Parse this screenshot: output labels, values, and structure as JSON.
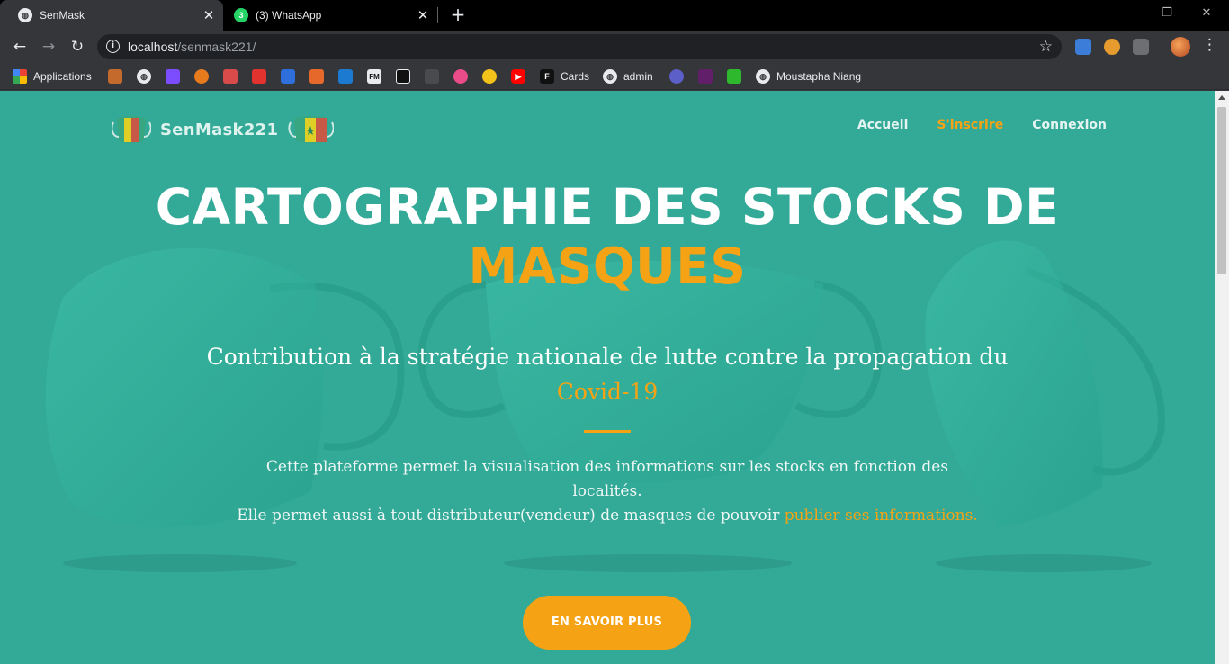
{
  "browser": {
    "tabs": [
      {
        "title": "SenMask",
        "active": true
      },
      {
        "title": "(3) WhatsApp",
        "active": false,
        "badge": "3"
      }
    ],
    "url_host": "localhost",
    "url_path": "/senmask221/",
    "bookmarks": {
      "apps_label": "Applications",
      "cards_label": "Cards",
      "admin_label": "admin",
      "profile_label": "Moustapha Niang",
      "fm_label": "FM"
    }
  },
  "colors": {
    "page_background": "#33a997",
    "accent": "#f5a314",
    "text": "#ffffff"
  },
  "site": {
    "brand": "SenMask221",
    "nav": [
      {
        "label": "Accueil",
        "active": false
      },
      {
        "label": "S'inscrire",
        "active": true
      },
      {
        "label": "Connexion",
        "active": false
      }
    ],
    "hero": {
      "title_line1": "CARTOGRAPHIE DES STOCKS DE",
      "title_accent": "MASQUES",
      "subtitle": "Contribution à la stratégie nationale de lutte contre la propagation du",
      "subtitle_accent": "Covid-19",
      "desc_line1": "Cette plateforme permet la visualisation des informations sur les stocks en fonction des localités.",
      "desc_line2": "Elle permet aussi à tout distributeur(vendeur) de masques de pouvoir",
      "desc_link": "publier ses informations.",
      "cta": "EN SAVOIR PLUS"
    }
  }
}
